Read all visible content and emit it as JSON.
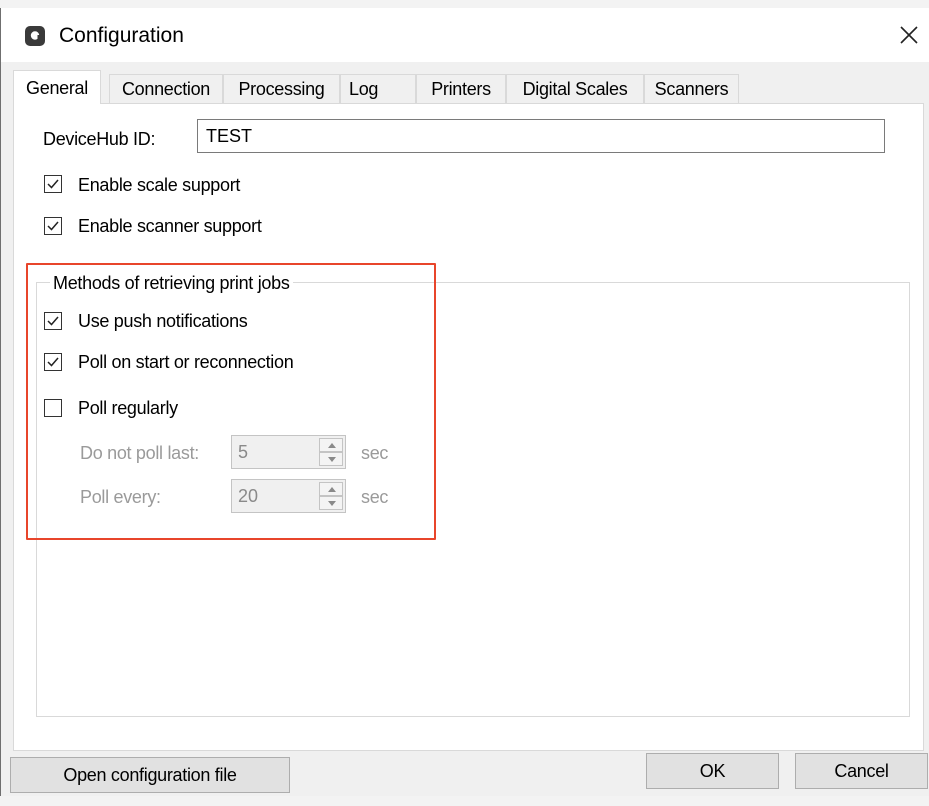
{
  "window": {
    "title": "Configuration",
    "close_glyph": "✕"
  },
  "tabs": [
    "General",
    "Connection",
    "Processing",
    "Log",
    "Printers",
    "Digital Scales",
    "Scanners"
  ],
  "active_tab": "General",
  "general": {
    "devicehub_id_label": "DeviceHub ID:",
    "devicehub_id_value": "TEST",
    "enable_scale_support": {
      "label": "Enable scale support",
      "checked": true
    },
    "enable_scanner_support": {
      "label": "Enable scanner support",
      "checked": true
    }
  },
  "retrieval": {
    "caption": "Methods of retrieving print jobs",
    "use_push": {
      "label": "Use push notifications",
      "checked": true
    },
    "poll_on_start": {
      "label": "Poll on start or reconnection",
      "checked": true
    },
    "poll_regularly": {
      "label": "Poll regularly",
      "checked": false
    },
    "do_not_poll_last": {
      "label": "Do not poll last:",
      "value": "5",
      "unit": "sec"
    },
    "poll_every": {
      "label": "Poll every:",
      "value": "20",
      "unit": "sec"
    }
  },
  "footer": {
    "open_config_label": "Open configuration file",
    "ok_label": "OK",
    "cancel_label": "Cancel"
  },
  "colors": {
    "highlight": "#e8452b",
    "dialog_bg": "#f0f0f0",
    "disabled_text": "#9a9a9a"
  }
}
